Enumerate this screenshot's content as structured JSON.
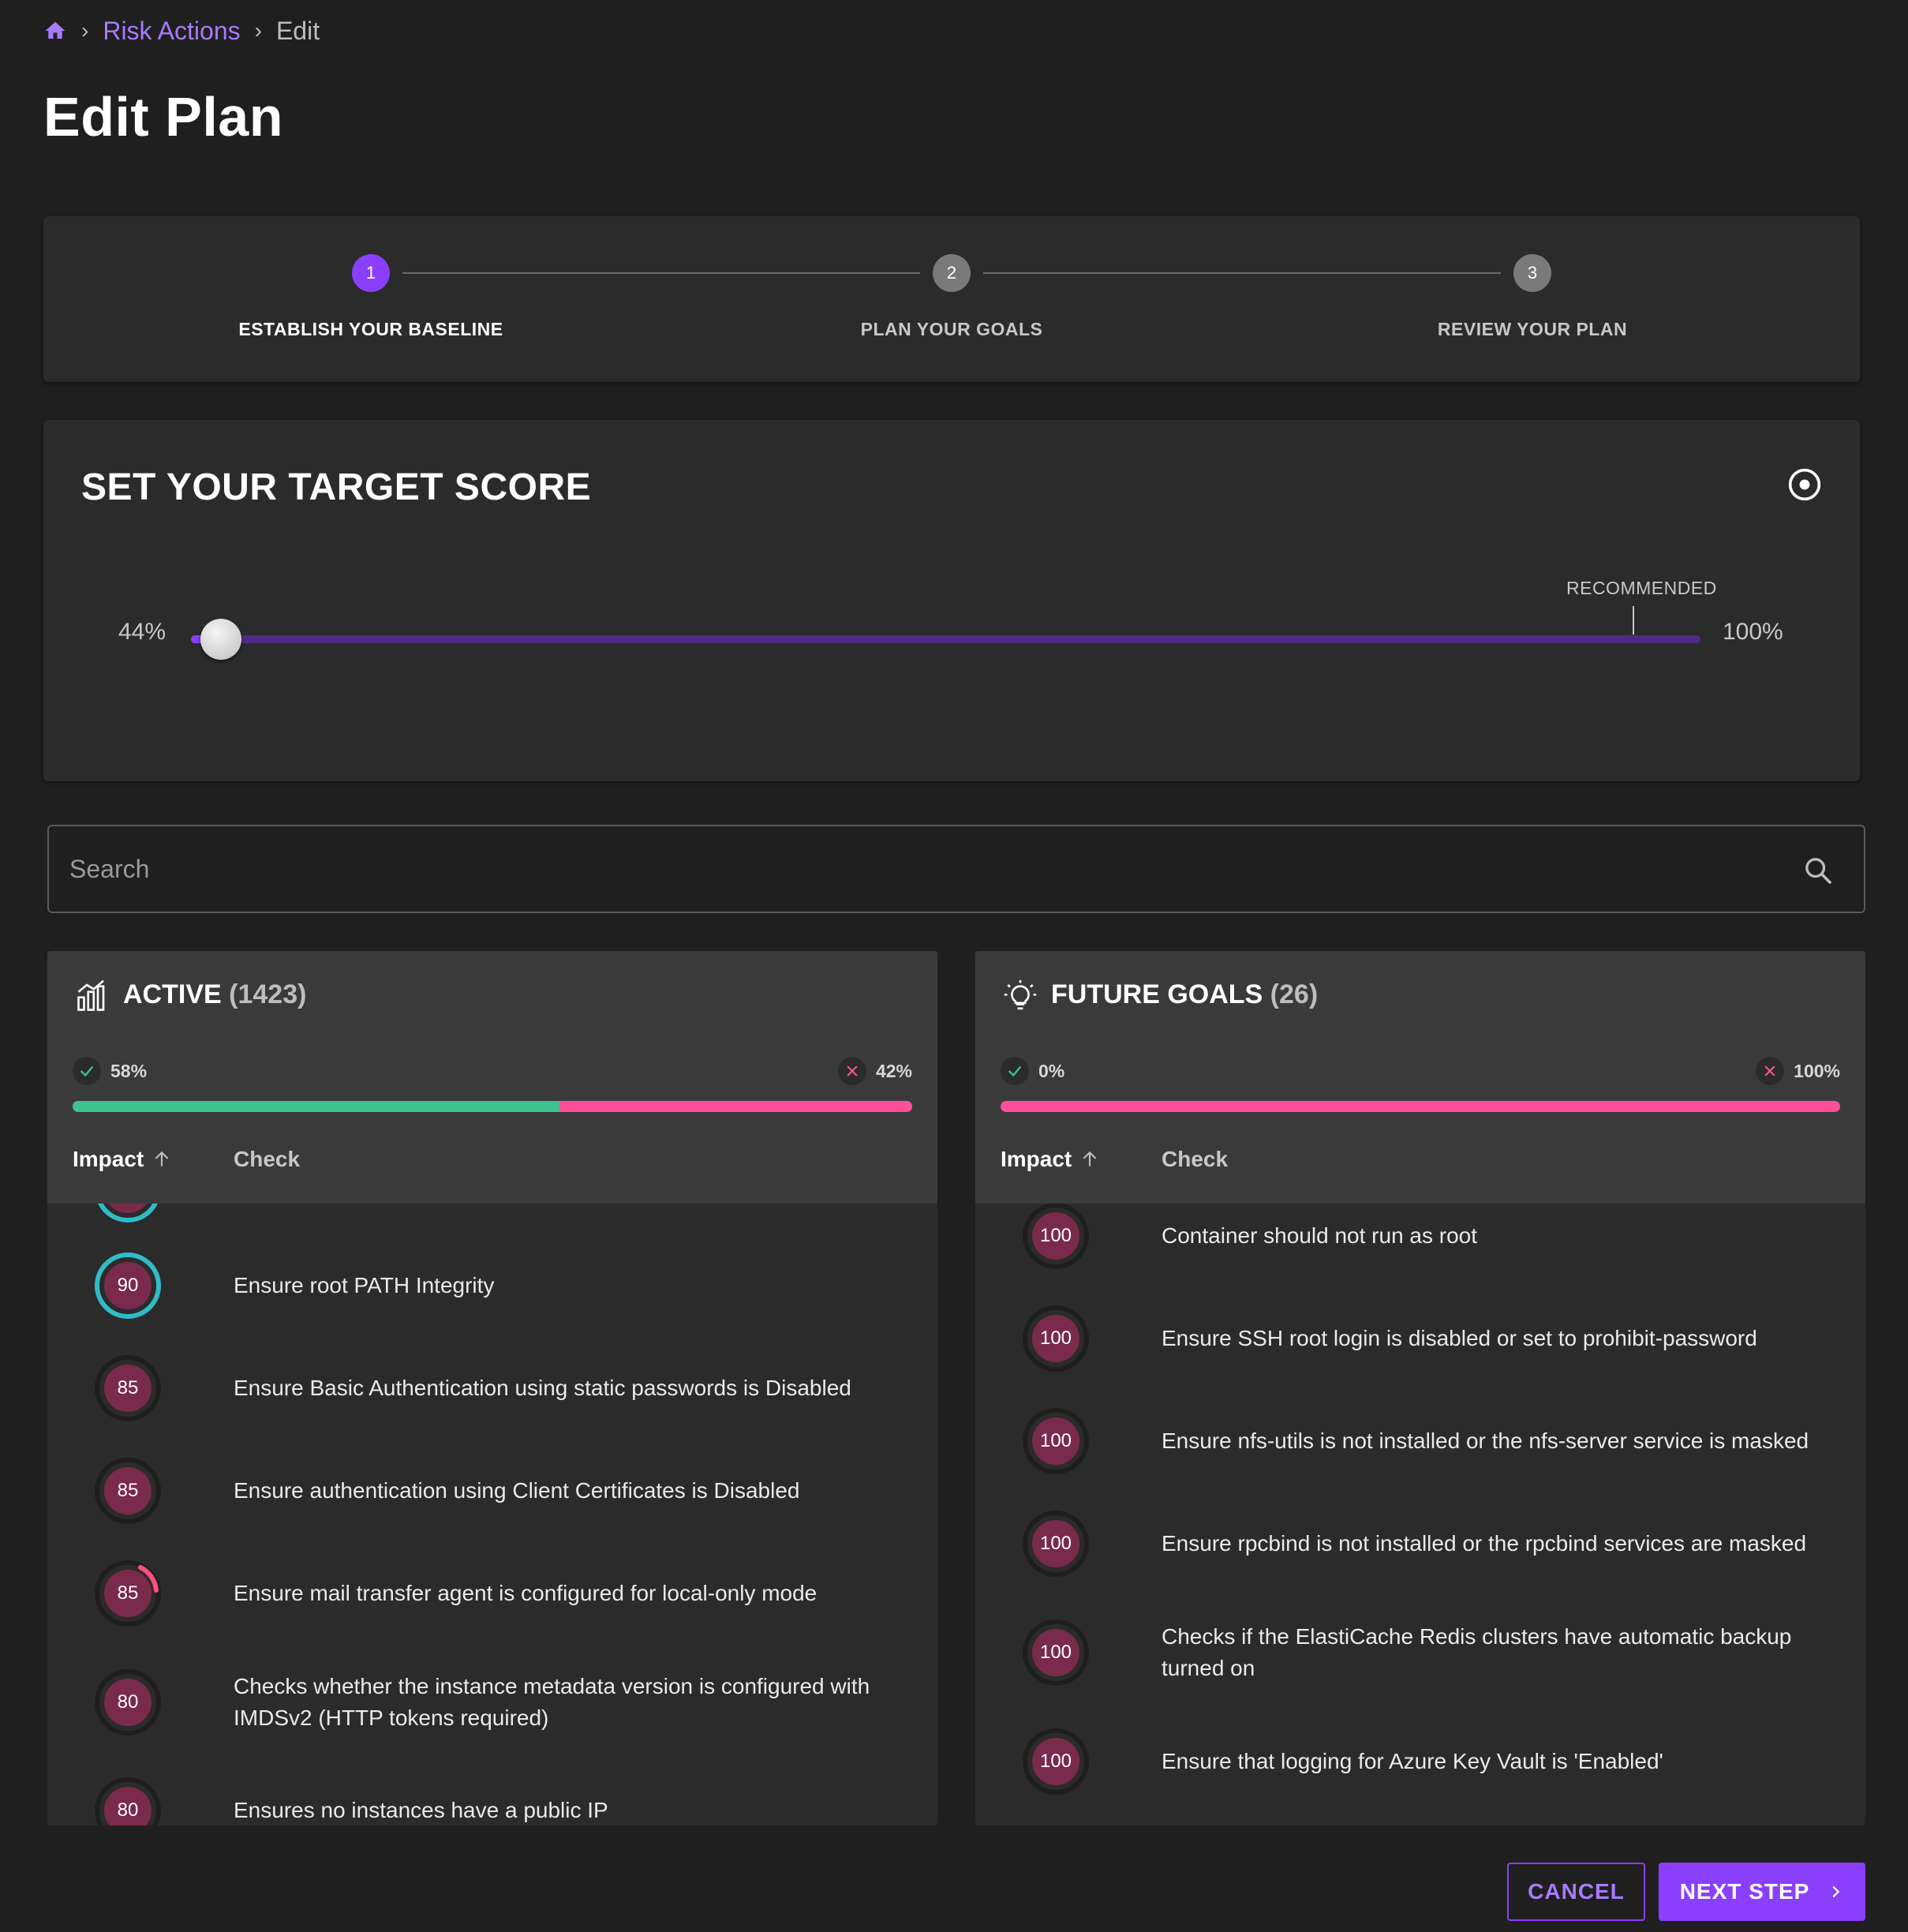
{
  "breadcrumb": {
    "parent": "Risk Actions",
    "current": "Edit"
  },
  "page": {
    "title": "Edit Plan"
  },
  "stepper": {
    "steps": [
      {
        "number": "1",
        "label": "ESTABLISH YOUR BASELINE",
        "state": "active"
      },
      {
        "number": "2",
        "label": "PLAN YOUR GOALS",
        "state": "todo"
      },
      {
        "number": "3",
        "label": "REVIEW YOUR PLAN",
        "state": "todo"
      }
    ]
  },
  "target": {
    "title": "SET YOUR TARGET SCORE",
    "min_label": "44%",
    "max_label": "100%",
    "recommended_label": "RECOMMENDED",
    "slider_value_fraction": 0.02,
    "recommended_fraction": 0.955
  },
  "search": {
    "placeholder": "Search",
    "value": ""
  },
  "active": {
    "title": "ACTIVE",
    "count": "(1423)",
    "pass_pct": "58%",
    "fail_pct": "42%",
    "pass_fraction": 0.58,
    "col_impact": "Impact",
    "col_check": "Check",
    "rows": [
      {
        "impact": "90",
        "check": "Ensure root PATH Integrity"
      },
      {
        "impact": "85",
        "check": "Ensure Basic Authentication using static passwords is Disabled"
      },
      {
        "impact": "85",
        "check": "Ensure authentication using Client Certificates is Disabled"
      },
      {
        "impact": "85",
        "check": "Ensure mail transfer agent is configured for local-only mode"
      },
      {
        "impact": "80",
        "check": "Checks whether the instance metadata version is configured with IMDSv2 (HTTP tokens required)"
      },
      {
        "impact": "80",
        "check": "Ensures no instances have a public IP"
      }
    ]
  },
  "future": {
    "title": "FUTURE GOALS",
    "count": "(26)",
    "pass_pct": "0%",
    "fail_pct": "100%",
    "pass_fraction": 0.0,
    "col_impact": "Impact",
    "col_check": "Check",
    "rows": [
      {
        "impact": "100",
        "check": "Container should not run as root"
      },
      {
        "impact": "100",
        "check": "Ensure SSH root login is disabled or set to prohibit-password"
      },
      {
        "impact": "100",
        "check": "Ensure nfs-utils is not installed or the nfs-server service is masked"
      },
      {
        "impact": "100",
        "check": "Ensure rpcbind is not installed or the rpcbind services are masked"
      },
      {
        "impact": "100",
        "check": "Checks if the ElastiCache Redis clusters have automatic backup turned on"
      },
      {
        "impact": "100",
        "check": "Ensure that logging for Azure Key Vault is 'Enabled'"
      }
    ]
  },
  "footer": {
    "cancel_label": "CANCEL",
    "next_label": "NEXT STEP"
  },
  "colors": {
    "accent": "#8a3ffc",
    "pass": "#3ec28f",
    "fail": "#ff4f9a",
    "impact_badge": "#7a2a4b",
    "selected_ring": "#2fbcc8"
  }
}
